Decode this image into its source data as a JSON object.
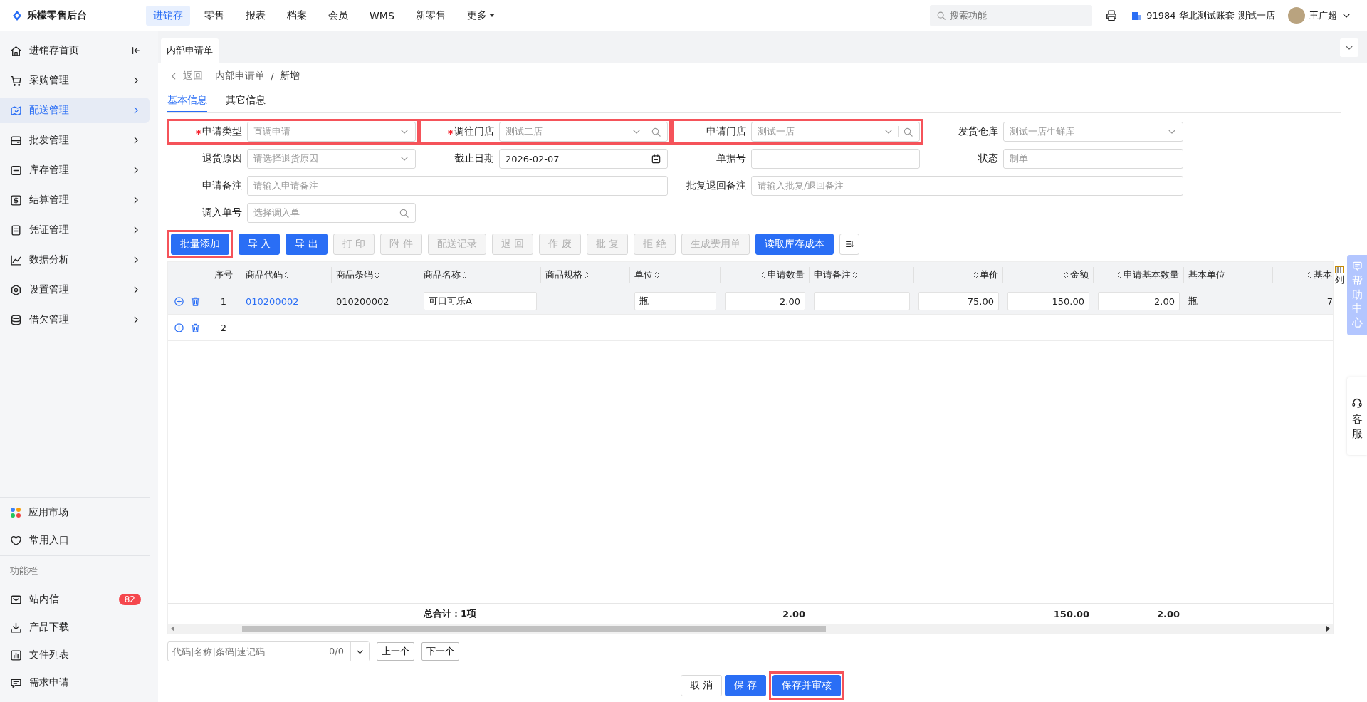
{
  "app": {
    "title": "乐檬零售后台"
  },
  "top_nav": [
    {
      "label": "进销存",
      "selected": true,
      "kind": "link"
    },
    {
      "label": "零售",
      "selected": false,
      "kind": "link"
    },
    {
      "label": "报表",
      "selected": false,
      "kind": "link"
    },
    {
      "label": "档案",
      "selected": false,
      "kind": "link"
    },
    {
      "label": "会员",
      "selected": false,
      "kind": "link"
    },
    {
      "label": "WMS",
      "selected": false,
      "kind": "link"
    },
    {
      "label": "新零售",
      "selected": false,
      "kind": "link"
    },
    {
      "label": "更多",
      "selected": false,
      "kind": "menu"
    }
  ],
  "search": {
    "placeholder": "搜索功能"
  },
  "account": "91984-华北测试账套-测试一店",
  "user": "王广超",
  "sidebar": {
    "items": [
      {
        "label": "进销存首页",
        "selected": false,
        "kind": "collapse"
      },
      {
        "label": "采购管理",
        "selected": false,
        "kind": "group"
      },
      {
        "label": "配送管理",
        "selected": true,
        "kind": "group"
      },
      {
        "label": "批发管理",
        "selected": false,
        "kind": "group"
      },
      {
        "label": "库存管理",
        "selected": false,
        "kind": "group"
      },
      {
        "label": "结算管理",
        "selected": false,
        "kind": "group"
      },
      {
        "label": "凭证管理",
        "selected": false,
        "kind": "group"
      },
      {
        "label": "数据分析",
        "selected": false,
        "kind": "group"
      },
      {
        "label": "设置管理",
        "selected": false,
        "kind": "group"
      },
      {
        "label": "借欠管理",
        "selected": false,
        "kind": "group"
      }
    ],
    "shortcuts": [
      {
        "label": "应用市场"
      },
      {
        "label": "常用入口"
      }
    ],
    "section_title": "功能栏",
    "tools": [
      {
        "label": "站内信",
        "badge": "82"
      },
      {
        "label": "产品下载"
      },
      {
        "label": "文件列表"
      },
      {
        "label": "需求申请"
      }
    ]
  },
  "page_tabs": [
    {
      "label": "内部申请单",
      "selected": true
    }
  ],
  "breadcrumb": {
    "back": "返回",
    "path": [
      "内部申请单"
    ],
    "separator": "/",
    "current": "新增"
  },
  "form_tabs": [
    {
      "label": "基本信息",
      "selected": true
    },
    {
      "label": "其它信息",
      "selected": false
    }
  ],
  "fields": [
    {
      "label": "申请类型",
      "required": true,
      "kind": "select",
      "value": "直调申请",
      "disabled": true,
      "highlighted": true,
      "wide": false
    },
    {
      "label": "调往门店",
      "required": true,
      "kind": "search-select",
      "value": "测试二店",
      "disabled": true,
      "highlighted": true,
      "wide": false
    },
    {
      "label": "申请门店",
      "required": false,
      "kind": "search-select",
      "value": "测试一店",
      "disabled": true,
      "highlighted": true,
      "wide": false
    },
    {
      "label": "发货仓库",
      "required": false,
      "kind": "select",
      "value": "测试一店生鲜库",
      "disabled": true,
      "highlighted": false,
      "wide": false
    },
    {
      "label": "退货原因",
      "required": false,
      "kind": "select",
      "placeholder": "请选择退货原因",
      "highlighted": false,
      "wide": false
    },
    {
      "label": "截止日期",
      "required": false,
      "kind": "date",
      "value": "2026-02-07",
      "disabled": false,
      "highlighted": false,
      "wide": false
    },
    {
      "label": "单据号",
      "required": false,
      "kind": "text",
      "highlighted": false,
      "wide": false
    },
    {
      "label": "状态",
      "required": false,
      "kind": "text",
      "value": "制单",
      "disabled": true,
      "highlighted": false,
      "wide": false
    },
    {
      "label": "申请备注",
      "required": false,
      "kind": "text",
      "placeholder": "请输入申请备注",
      "disabled": false,
      "highlighted": false,
      "wide": true
    },
    {
      "label": "批复退回备注",
      "required": false,
      "kind": "text",
      "placeholder": "请输入批复/退回备注",
      "disabled": false,
      "highlighted": false,
      "wide": true
    },
    {
      "label": "调入单号",
      "required": false,
      "kind": "search",
      "placeholder": "选择调入单",
      "highlighted": false,
      "wide": false
    }
  ],
  "toolbar": [
    {
      "label": "批量添加",
      "kind": "primary",
      "highlighted": true
    },
    {
      "label": "导 入",
      "kind": "primary",
      "highlighted": false
    },
    {
      "label": "导 出",
      "kind": "primary",
      "highlighted": false
    },
    {
      "label": "打 印",
      "kind": "disabled",
      "highlighted": false
    },
    {
      "label": "附 件",
      "kind": "disabled",
      "highlighted": false
    },
    {
      "label": "配送记录",
      "kind": "disabled",
      "highlighted": false
    },
    {
      "label": "退 回",
      "kind": "disabled",
      "highlighted": false
    },
    {
      "label": "作 废",
      "kind": "disabled",
      "highlighted": false
    },
    {
      "label": "批 复",
      "kind": "disabled",
      "highlighted": false
    },
    {
      "label": "拒 绝",
      "kind": "disabled",
      "highlighted": false
    },
    {
      "label": "生成费用单",
      "kind": "disabled",
      "highlighted": false
    },
    {
      "label": "读取库存成本",
      "kind": "primary",
      "highlighted": false
    },
    {
      "kind": "icon",
      "highlighted": false
    }
  ],
  "table": {
    "columns": [
      {
        "label": "序号",
        "sortable": false
      },
      {
        "label": "商品代码",
        "sortable": true
      },
      {
        "label": "商品条码",
        "sortable": true
      },
      {
        "label": "商品名称",
        "sortable": true
      },
      {
        "label": "商品规格",
        "sortable": true
      },
      {
        "label": "单位",
        "sortable": true
      },
      {
        "label": "申请数量",
        "sortable": true
      },
      {
        "label": "申请备注",
        "sortable": true
      },
      {
        "label": "单价",
        "sortable": true
      },
      {
        "label": "金额",
        "sortable": true
      },
      {
        "label": "申请基本数量",
        "sortable": true
      },
      {
        "label": "基本单位",
        "sortable": false
      },
      {
        "label": "基本",
        "sortable": true
      }
    ],
    "rows": [
      {
        "selected": true,
        "cells": [
          {
            "kind": "text",
            "text": "1"
          },
          {
            "kind": "link",
            "text": "010200002"
          },
          {
            "kind": "text",
            "text": "010200002"
          },
          {
            "kind": "input",
            "text": "可口可乐A"
          },
          {
            "kind": "blank"
          },
          {
            "kind": "input",
            "text": "瓶"
          },
          {
            "kind": "input",
            "text": "2.00"
          },
          {
            "kind": "input"
          },
          {
            "kind": "input",
            "text": "75.00"
          },
          {
            "kind": "input",
            "text": "150.00"
          },
          {
            "kind": "input",
            "text": "2.00"
          },
          {
            "kind": "text",
            "text": "瓶"
          },
          {
            "kind": "text",
            "text": "7"
          }
        ]
      },
      {
        "selected": false,
        "cells": [
          {
            "kind": "text",
            "text": "2"
          }
        ]
      }
    ],
    "summary": {
      "label": "总合计：1项",
      "quantity": "2.00",
      "amount": "150.00",
      "base_quantity": "2.00"
    },
    "column_settings": "列"
  },
  "finder": {
    "placeholder": "代码|名称|条码|速记码",
    "count": "0/0",
    "buttons": [
      "上一个",
      "下一个"
    ]
  },
  "footer": [
    {
      "label": "取 消",
      "kind": "default",
      "highlighted": false
    },
    {
      "label": "保 存",
      "kind": "primary",
      "highlighted": false
    },
    {
      "label": "保存并审核",
      "kind": "primary",
      "highlighted": true
    }
  ],
  "help": {
    "label": "帮助中心",
    "service": "客服"
  }
}
